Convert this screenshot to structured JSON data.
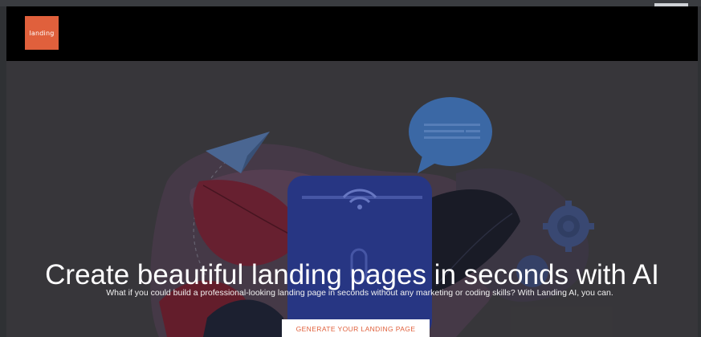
{
  "header": {
    "logo_text": "landing",
    "brand_color": "#e0603c"
  },
  "hero": {
    "title": "Create beautiful landing pages in seconds with AI",
    "subtitle": "What if you could build a professional-looking landing page in seconds without any marketing or coding skills? With Landing AI, you can.",
    "cta_label": "GENERATE YOUR LANDING PAGE"
  },
  "illustration": {
    "icons": [
      "paper-plane-icon",
      "chat-bubble-icon",
      "wifi-icon",
      "gear-icon",
      "phone-icon"
    ]
  }
}
